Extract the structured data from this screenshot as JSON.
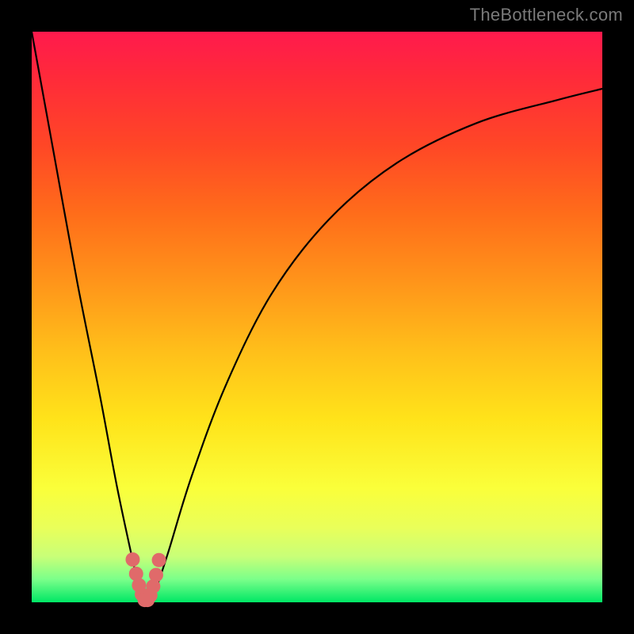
{
  "watermark": "TheBottleneck.com",
  "chart_data": {
    "type": "line",
    "title": "",
    "xlabel": "",
    "ylabel": "",
    "xlim": [
      0,
      100
    ],
    "ylim": [
      0,
      100
    ],
    "grid": false,
    "series": [
      {
        "name": "bottleneck-curve",
        "x": [
          0,
          4,
          8,
          12,
          15,
          18,
          19,
          20,
          21,
          22,
          24,
          28,
          34,
          42,
          52,
          64,
          78,
          92,
          100
        ],
        "y": [
          100,
          78,
          56,
          36,
          20,
          6,
          2,
          0,
          1,
          3,
          9,
          22,
          38,
          54,
          67,
          77,
          84,
          88,
          90
        ]
      }
    ],
    "markers": {
      "name": "highlight-dots",
      "color": "#e06a6a",
      "x": [
        17.7,
        18.3,
        18.8,
        19.3,
        19.8,
        20.3,
        20.8,
        21.3,
        21.8,
        22.3
      ],
      "y": [
        7.5,
        5.0,
        3.0,
        1.4,
        0.4,
        0.4,
        1.2,
        2.8,
        4.8,
        7.4
      ]
    },
    "background_gradient": {
      "top": "#ff1a4d",
      "mid": "#ffd21a",
      "bottom": "#00e765"
    }
  }
}
